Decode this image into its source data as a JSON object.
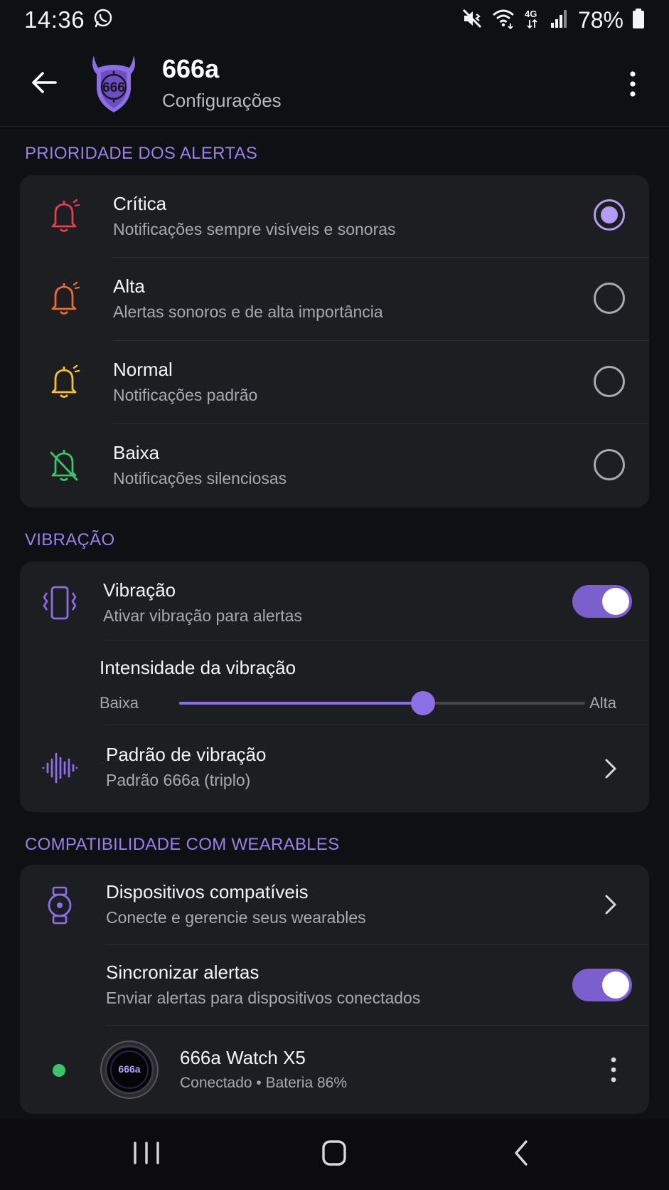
{
  "status_bar": {
    "time": "14:36",
    "battery": "78%",
    "icons": [
      "whatsapp-icon",
      "mute-vibrate-icon",
      "wifi-icon",
      "network-4g-icon",
      "signal-icon",
      "battery-icon"
    ]
  },
  "app_bar": {
    "title": "666a",
    "subtitle": "Configurações",
    "logo_text": "666"
  },
  "sections": {
    "priority": {
      "header": "PRIORIDADE DOS ALERTAS",
      "options": [
        {
          "title": "Crítica",
          "subtitle": "Notificações sempre visíveis e sonoras",
          "icon": "bell-ring-icon",
          "color": "#e0404e",
          "selected": true
        },
        {
          "title": "Alta",
          "subtitle": "Alertas sonoros e de alta importância",
          "icon": "bell-ring-icon",
          "color": "#ea6a33",
          "selected": false
        },
        {
          "title": "Normal",
          "subtitle": "Notificações padrão",
          "icon": "bell-ring-icon",
          "color": "#f2c230",
          "selected": false
        },
        {
          "title": "Baixa",
          "subtitle": "Notificações silenciosas",
          "icon": "bell-off-icon",
          "color": "#3cc46b",
          "selected": false
        }
      ]
    },
    "vibration": {
      "header": "VIBRAÇÃO",
      "toggle_title": "Vibração",
      "toggle_subtitle": "Ativar vibração para alertas",
      "toggle_on": true,
      "intensity_title": "Intensidade da vibração",
      "intensity_low": "Baixa",
      "intensity_high": "Alta",
      "intensity_value": 0.6,
      "pattern_title": "Padrão de vibração",
      "pattern_subtitle": "Padrão 666a (triplo)"
    },
    "wearables": {
      "header": "COMPATIBILIDADE COM WEARABLES",
      "devices_title": "Dispositivos compatíveis",
      "devices_subtitle": "Conecte e gerencie seus wearables",
      "sync_title": "Sincronizar alertas",
      "sync_subtitle": "Enviar alertas para dispositivos conectados",
      "sync_on": true,
      "device_name": "666a Watch X5",
      "device_status": "Conectado • Bateria 86%",
      "device_watch_text": "666a"
    }
  },
  "colors": {
    "accent": "#8c6fe4",
    "section_header": "#9a80ea",
    "card_bg": "#1d1e22",
    "connected_dot": "#3cc46b"
  }
}
